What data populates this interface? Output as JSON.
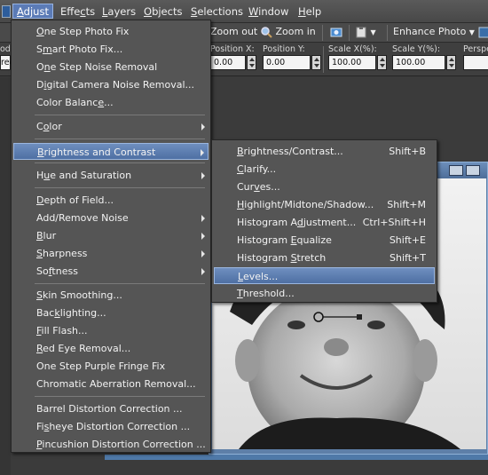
{
  "menubar": {
    "items": [
      {
        "pre": "F",
        "u": "i",
        "post": "le"
      },
      {
        "pre": "",
        "u": "A",
        "post": "djust"
      },
      {
        "pre": "Effe",
        "u": "c",
        "post": "ts"
      },
      {
        "pre": "",
        "u": "L",
        "post": "ayers"
      },
      {
        "pre": "",
        "u": "O",
        "post": "bjects"
      },
      {
        "pre": "",
        "u": "S",
        "post": "elections"
      },
      {
        "pre": "",
        "u": "W",
        "post": "indow"
      },
      {
        "pre": "",
        "u": "H",
        "post": "elp"
      }
    ]
  },
  "toolbar": {
    "zoom_out": "Zoom out",
    "zoom_in": "Zoom in",
    "enhance_photo": "Enhance Photo",
    "enhance_caret": "▼",
    "paste_caret": "▼"
  },
  "propbar": {
    "position_x_label": "Position X:",
    "position_x_value": "0.00",
    "position_y_label": "Position Y:",
    "position_y_value": "0.00",
    "scale_x_label": "Scale X(%):",
    "scale_x_value": "100.00",
    "scale_y_label": "Scale Y(%):",
    "scale_y_value": "100.00",
    "perspective_label": "Perspe",
    "left_label": "ode",
    "left_value": "ree"
  },
  "adjust_menu": {
    "items": [
      {
        "pre": "",
        "u": "O",
        "post": "ne Step Photo Fix",
        "arrow": false
      },
      {
        "pre": "S",
        "u": "m",
        "post": "art Photo Fix...",
        "arrow": false
      },
      {
        "pre": "O",
        "u": "n",
        "post": "e Step Noise Removal",
        "arrow": false
      },
      {
        "pre": "D",
        "u": "i",
        "post": "gital Camera Noise Removal...",
        "arrow": false
      },
      {
        "pre": "Color Balanc",
        "u": "e",
        "post": "...",
        "arrow": false
      },
      {
        "pre": "C",
        "u": "o",
        "post": "lor",
        "arrow": true
      },
      {
        "pre": "",
        "u": "B",
        "post": "rightness and Contrast",
        "arrow": true,
        "highlight": true
      },
      {
        "pre": "H",
        "u": "u",
        "post": "e and Saturation",
        "arrow": true
      },
      {
        "pre": "",
        "u": "D",
        "post": "epth of Field...",
        "arrow": false
      },
      {
        "pre": "Add/Remove Noise",
        "u": "",
        "post": "",
        "arrow": true
      },
      {
        "pre": "",
        "u": "B",
        "post": "lur",
        "arrow": true
      },
      {
        "pre": "",
        "u": "S",
        "post": "harpness",
        "arrow": true
      },
      {
        "pre": "So",
        "u": "f",
        "post": "tness",
        "arrow": true
      },
      {
        "pre": "",
        "u": "S",
        "post": "kin Smoothing...",
        "arrow": false
      },
      {
        "pre": "Bac",
        "u": "k",
        "post": "lighting...",
        "arrow": false
      },
      {
        "pre": "",
        "u": "F",
        "post": "ill Flash...",
        "arrow": false
      },
      {
        "pre": "",
        "u": "R",
        "post": "ed Eye Removal...",
        "arrow": false
      },
      {
        "pre": "One Step Purple Fringe Fix",
        "u": "",
        "post": "",
        "arrow": false
      },
      {
        "pre": "Chromatic Aberration Removal...",
        "u": "",
        "post": "",
        "arrow": false
      },
      {
        "pre": "Barrel Distortion Correction ...",
        "u": "",
        "post": "",
        "arrow": false
      },
      {
        "pre": "Fi",
        "u": "s",
        "post": "heye Distortion Correction ...",
        "arrow": false
      },
      {
        "pre": "",
        "u": "P",
        "post": "incushion Distortion Correction ...",
        "arrow": false
      }
    ]
  },
  "bc_submenu": {
    "items": [
      {
        "pre": "",
        "u": "B",
        "post": "rightness/Contrast...",
        "shortcut": "Shift+B"
      },
      {
        "pre": "",
        "u": "C",
        "post": "larify...",
        "shortcut": ""
      },
      {
        "pre": "Cur",
        "u": "v",
        "post": "es...",
        "shortcut": ""
      },
      {
        "pre": "",
        "u": "H",
        "post": "ighlight/Midtone/Shadow...",
        "shortcut": "Shift+M"
      },
      {
        "pre": "Histogram A",
        "u": "d",
        "post": "justment...",
        "shortcut": "Ctrl+Shift+H"
      },
      {
        "pre": "Histogram ",
        "u": "E",
        "post": "qualize",
        "shortcut": "Shift+E"
      },
      {
        "pre": "Histogram ",
        "u": "S",
        "post": "tretch",
        "shortcut": "Shift+T"
      },
      {
        "pre": "",
        "u": "L",
        "post": "evels...",
        "shortcut": "",
        "highlight": true
      },
      {
        "pre": "",
        "u": "T",
        "post": "hreshold...",
        "shortcut": ""
      }
    ]
  }
}
